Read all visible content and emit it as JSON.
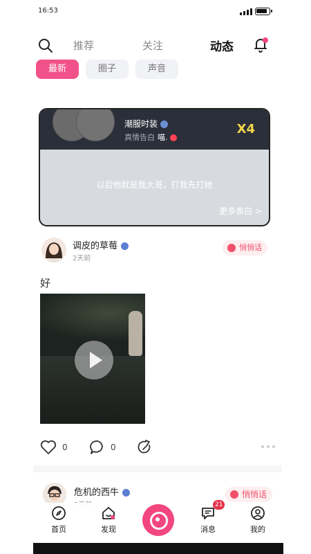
{
  "status_bar": {
    "time": "16:53"
  },
  "top_nav": {
    "tabs": [
      {
        "label": "推荐"
      },
      {
        "label": "关注"
      },
      {
        "label": "动态"
      }
    ]
  },
  "sub_tabs": [
    {
      "label": "最新"
    },
    {
      "label": "圈子"
    },
    {
      "label": "声音"
    }
  ],
  "confession_card": {
    "nickname": "潮服时装",
    "subtitle_prefix": "真情告白",
    "subtitle_name": "喵.",
    "multiplier": "X4",
    "message": "以后他就是我大哥，打我先打她",
    "more_label": "更多表白 >"
  },
  "post": {
    "username": "调皮的草莓",
    "time": "2天前",
    "whisper_label": "悄悄话",
    "text": "好",
    "likes": "0",
    "comments": "0"
  },
  "next_post": {
    "username": "危机的西牛",
    "time": "2天前",
    "whisper_label": "悄悄话"
  },
  "tab_bar": {
    "items": [
      {
        "label": "首页"
      },
      {
        "label": "发现"
      },
      {
        "label": ""
      },
      {
        "label": "消息"
      },
      {
        "label": "我的"
      }
    ],
    "message_badge": "21"
  }
}
